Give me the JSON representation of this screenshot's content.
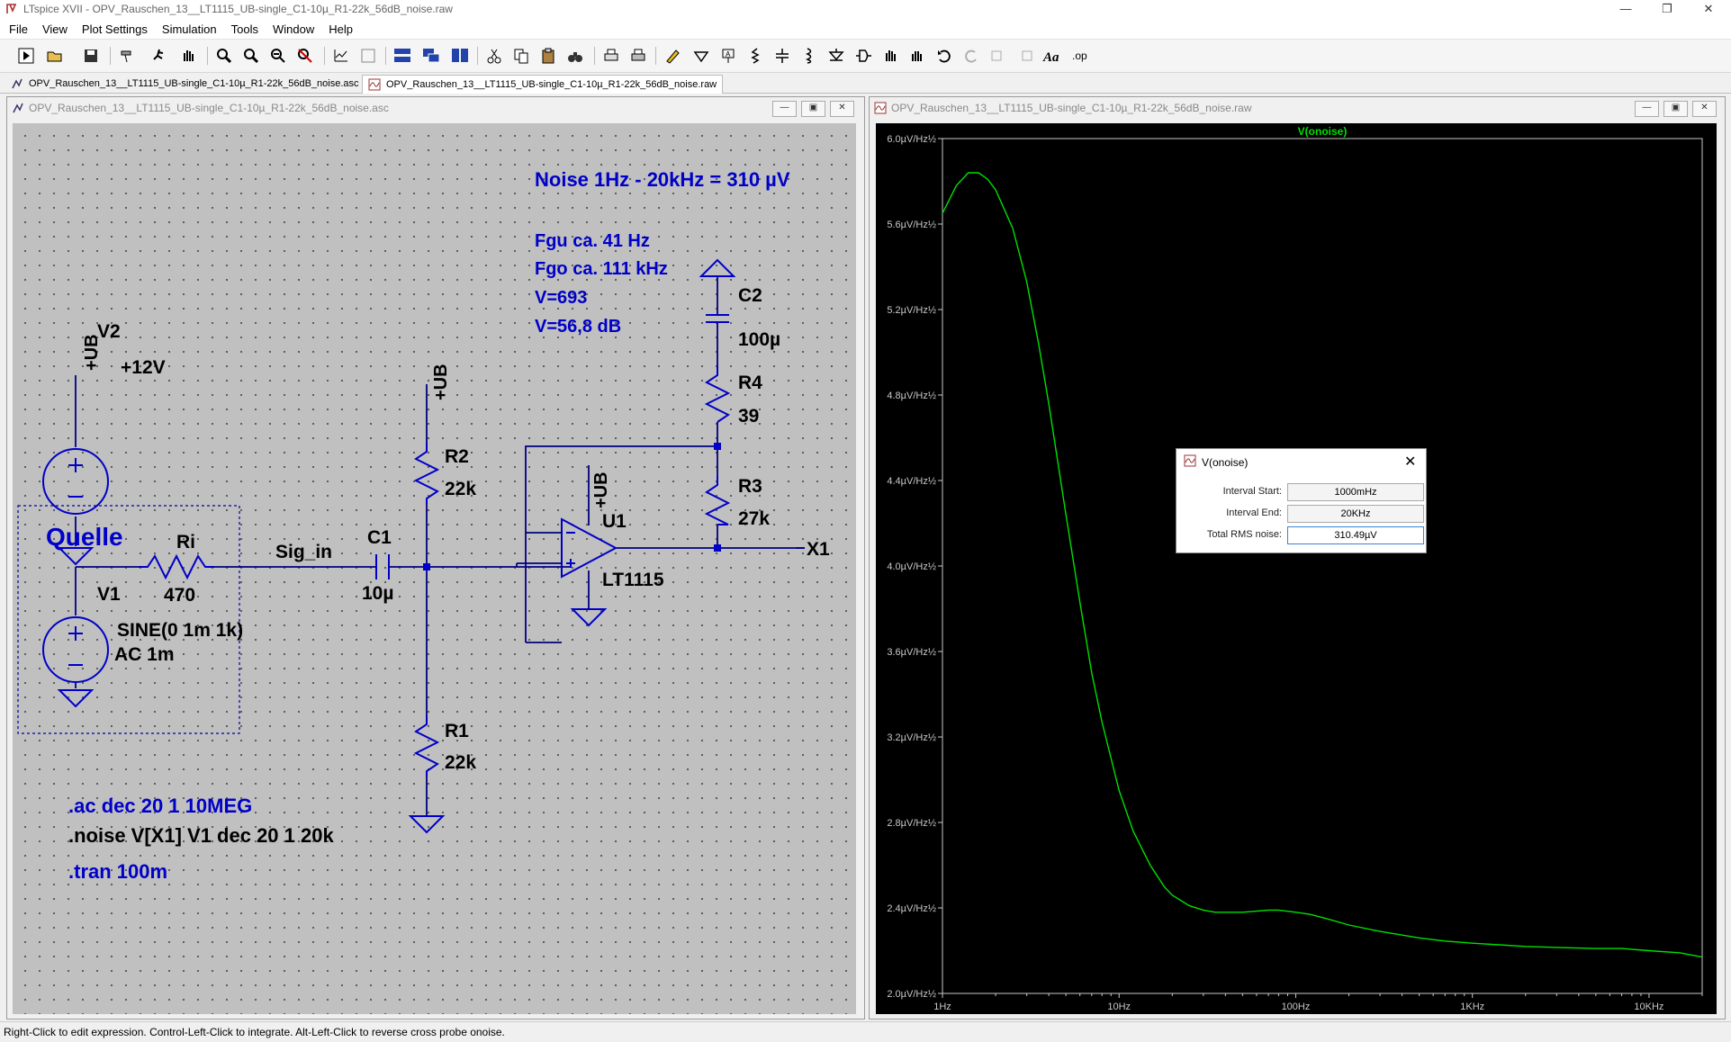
{
  "app": {
    "title": "LTspice XVII - OPV_Rauschen_13__LT1115_UB-single_C1-10µ_R1-22k_56dB_noise.raw",
    "window_controls": [
      "—",
      "❐",
      "✕"
    ]
  },
  "menu": [
    "File",
    "View",
    "Plot Settings",
    "Simulation",
    "Tools",
    "Window",
    "Help"
  ],
  "tabs": [
    {
      "label": "OPV_Rauschen_13__LT1115_UB-single_C1-10µ_R1-22k_56dB_noise.asc",
      "icon": "schematic-icon"
    },
    {
      "label": "OPV_Rauschen_13__LT1115_UB-single_C1-10µ_R1-22k_56dB_noise.raw",
      "icon": "waveform-icon"
    }
  ],
  "schematic_window": {
    "title": "OPV_Rauschen_13__LT1115_UB-single_C1-10µ_R1-22k_56dB_noise.asc"
  },
  "plot_window": {
    "title": "OPV_Rauschen_13__LT1115_UB-single_C1-10µ_R1-22k_56dB_noise.raw"
  },
  "schematic": {
    "noise_note": "Noise 1Hz - 20kHz = 310 µV",
    "fgu": "Fgu ca. 41 Hz",
    "fgo": "Fgo ca. 111 kHz",
    "gain": "V=693",
    "gain_db": "V=56,8 dB",
    "quelle": "Quelle",
    "ub": "+UB",
    "v2_name": "V2",
    "v2_value": "+12V",
    "v1_name": "V1",
    "v1_value": "SINE(0 1m 1k)",
    "v1_ac": "AC 1m",
    "ri_name": "Ri",
    "ri_value": "470",
    "sig_in": "Sig_in",
    "c1_name": "C1",
    "c1_value": "10µ",
    "r2_name": "R2",
    "r2_value": "22k",
    "r1_name": "R1",
    "r1_value": "22k",
    "c2_name": "C2",
    "c2_value": "100µ",
    "r4_name": "R4",
    "r4_value": "39",
    "r3_name": "R3",
    "r3_value": "27k",
    "u1_name": "U1",
    "u1_value": "LT1115",
    "out_label": "X1",
    "dir_ac": ".ac dec 20 1 10MEG",
    "dir_noise": ".noise V[X1] V1 dec 20 1 20k",
    "dir_tran": ".tran 100m",
    "color_text_blue": "#0000c8",
    "color_wire": "#000080"
  },
  "chart_data": {
    "type": "line",
    "title": "V(onoise)",
    "xlabel": "",
    "ylabel": "",
    "x_scale": "log",
    "xlim": [
      1,
      20000
    ],
    "ylim": [
      2.0,
      6.0
    ],
    "x_ticks": [
      "1Hz",
      "10Hz",
      "100Hz",
      "1KHz",
      "10KHz"
    ],
    "y_ticks": [
      "2.0µV/Hz½",
      "2.4µV/Hz½",
      "2.8µV/Hz½",
      "3.2µV/Hz½",
      "3.6µV/Hz½",
      "4.0µV/Hz½",
      "4.4µV/Hz½",
      "4.8µV/Hz½",
      "5.2µV/Hz½",
      "5.6µV/Hz½",
      "6.0µV/Hz½"
    ],
    "y_unit": "µV/Hz½",
    "series": [
      {
        "name": "V(onoise)",
        "color": "#00e000",
        "x": [
          1,
          1.2,
          1.4,
          1.6,
          1.8,
          2,
          2.5,
          3,
          3.5,
          4,
          5,
          6,
          7,
          8,
          10,
          12,
          15,
          18,
          20,
          25,
          30,
          35,
          40,
          50,
          60,
          70,
          80,
          100,
          120,
          150,
          200,
          300,
          500,
          700,
          1000,
          2000,
          3000,
          5000,
          7000,
          10000,
          15000,
          20000
        ],
        "values": [
          5.65,
          5.78,
          5.84,
          5.84,
          5.81,
          5.76,
          5.58,
          5.33,
          5.04,
          4.76,
          4.24,
          3.83,
          3.5,
          3.27,
          2.95,
          2.76,
          2.6,
          2.5,
          2.46,
          2.41,
          2.39,
          2.38,
          2.38,
          2.38,
          2.385,
          2.39,
          2.39,
          2.38,
          2.37,
          2.35,
          2.32,
          2.29,
          2.26,
          2.245,
          2.235,
          2.22,
          2.215,
          2.21,
          2.21,
          2.2,
          2.19,
          2.17
        ]
      }
    ]
  },
  "dialog": {
    "title": "V(onoise)",
    "interval_start_label": "Interval Start:",
    "interval_start_value": "1000mHz",
    "interval_end_label": "Interval End:",
    "interval_end_value": "20KHz",
    "rms_label": "Total RMS noise:",
    "rms_value": "310.49µV"
  },
  "status": "Right-Click to edit expression. Control-Left-Click to integrate. Alt-Left-Click to reverse cross probe onoise."
}
